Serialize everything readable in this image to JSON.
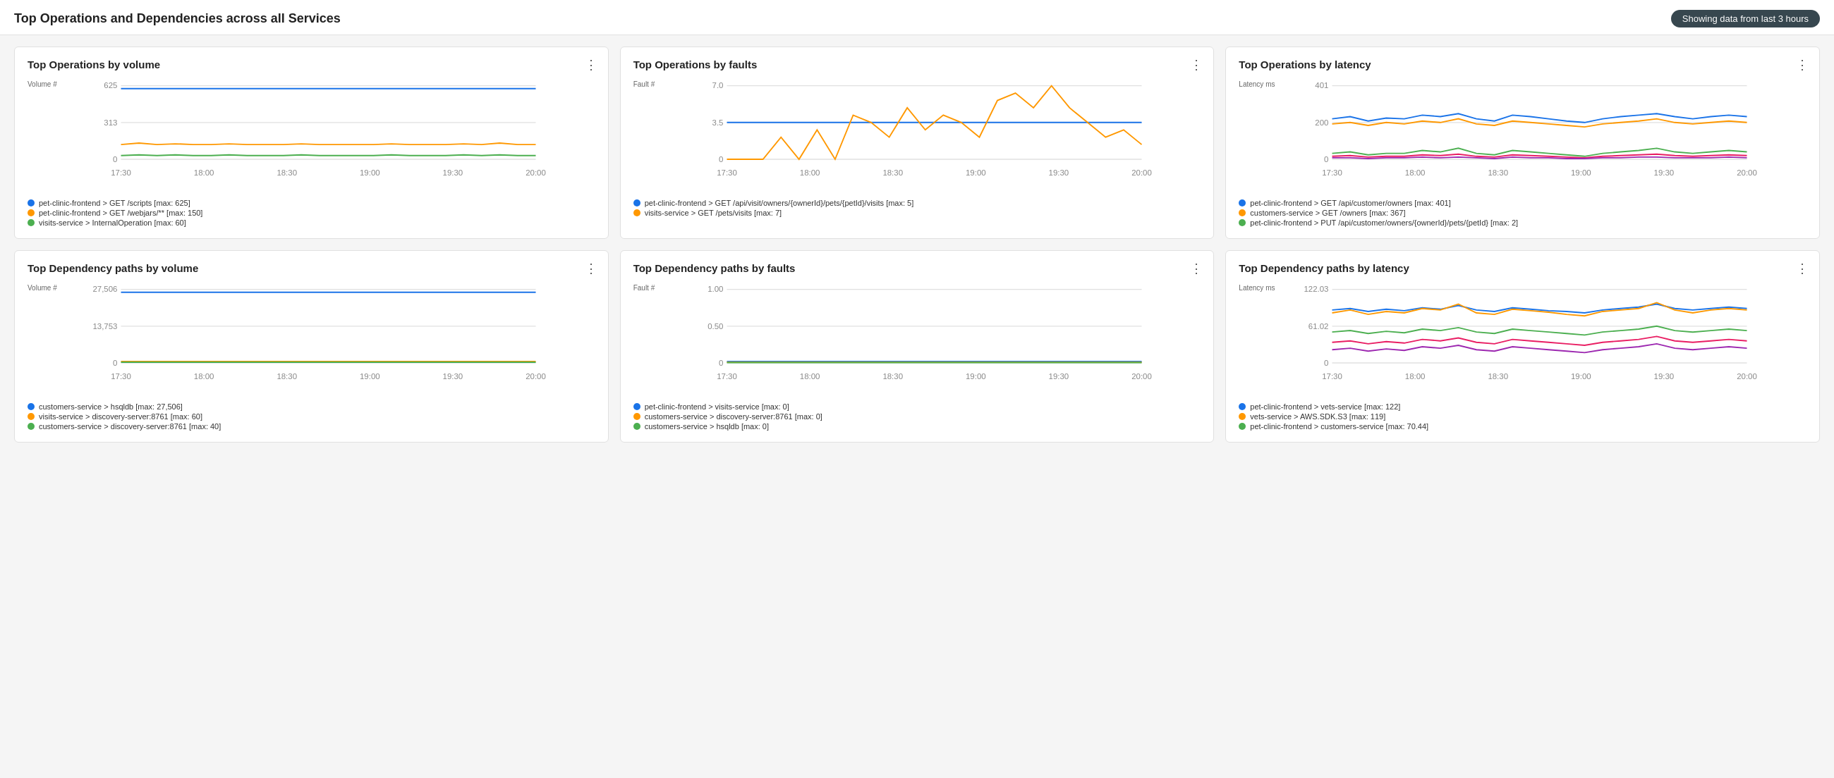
{
  "header": {
    "title": "Top Operations and Dependencies across all Services",
    "time_badge": "Showing data from last 3 hours"
  },
  "cards": [
    {
      "id": "top-ops-volume",
      "title": "Top Operations by volume",
      "y_axis_label": "Volume #",
      "y_ticks": [
        "625",
        "313",
        "0"
      ],
      "x_ticks": [
        "17:30",
        "18:00",
        "18:30",
        "19:00",
        "19:30",
        "20:00"
      ],
      "series": [
        {
          "color": "#1a73e8",
          "label": "pet-clinic-frontend > GET /scripts [max: 625]",
          "values": [
            0.96,
            0.96,
            0.96,
            0.96,
            0.96,
            0.96,
            0.96,
            0.96,
            0.96,
            0.96,
            0.96,
            0.96,
            0.96,
            0.96,
            0.96,
            0.96,
            0.96,
            0.96,
            0.96,
            0.96,
            0.96,
            0.96,
            0.96,
            0.96
          ]
        },
        {
          "color": "#ff9800",
          "label": "pet-clinic-frontend > GET /webjars/** [max: 150]",
          "values": [
            0.2,
            0.22,
            0.2,
            0.21,
            0.2,
            0.2,
            0.21,
            0.2,
            0.2,
            0.2,
            0.21,
            0.2,
            0.2,
            0.2,
            0.2,
            0.21,
            0.2,
            0.2,
            0.2,
            0.21,
            0.2,
            0.22,
            0.2,
            0.2
          ]
        },
        {
          "color": "#4caf50",
          "label": "visits-service > InternalOperation [max: 60]",
          "values": [
            0.05,
            0.06,
            0.05,
            0.06,
            0.05,
            0.05,
            0.06,
            0.05,
            0.05,
            0.05,
            0.06,
            0.05,
            0.05,
            0.05,
            0.05,
            0.06,
            0.05,
            0.05,
            0.05,
            0.06,
            0.05,
            0.06,
            0.05,
            0.05
          ]
        }
      ]
    },
    {
      "id": "top-ops-faults",
      "title": "Top Operations by faults",
      "y_axis_label": "Fault #",
      "y_ticks": [
        "7.0",
        "3.5",
        "0"
      ],
      "x_ticks": [
        "17:30",
        "18:00",
        "18:30",
        "19:00",
        "19:30",
        "20:00"
      ],
      "series": [
        {
          "color": "#1a73e8",
          "label": "pet-clinic-frontend > GET /api/visit/owners/{ownerId}/pets/{petId}/visits [max: 5]",
          "values": [
            0.5,
            0.5,
            0.5,
            0.5,
            0.5,
            0.5,
            0.5,
            0.5,
            0.5,
            0.5,
            0.5,
            0.5,
            0.5,
            0.5,
            0.5,
            0.5,
            0.5,
            0.5,
            0.5,
            0.5,
            0.5,
            0.5,
            0.5,
            0.5
          ]
        },
        {
          "color": "#ff9800",
          "label": "visits-service > GET /pets/visits [max: 7]",
          "values": [
            0,
            0,
            0,
            0.3,
            0,
            0.4,
            0,
            0.6,
            0.5,
            0.3,
            0.7,
            0.4,
            0.6,
            0.5,
            0.3,
            0.8,
            0.9,
            0.7,
            1.0,
            0.7,
            0.5,
            0.3,
            0.4,
            0.2
          ]
        }
      ]
    },
    {
      "id": "top-ops-latency",
      "title": "Top Operations by latency",
      "y_axis_label": "Latency ms",
      "y_ticks": [
        "401",
        "200",
        "0"
      ],
      "x_ticks": [
        "17:30",
        "18:00",
        "18:30",
        "19:00",
        "19:30",
        "20:00"
      ],
      "series": [
        {
          "color": "#1a73e8",
          "label": "pet-clinic-frontend > GET /api/customer/owners [max: 401]",
          "values": [
            0.55,
            0.58,
            0.52,
            0.56,
            0.55,
            0.6,
            0.58,
            0.62,
            0.55,
            0.52,
            0.6,
            0.58,
            0.55,
            0.52,
            0.5,
            0.55,
            0.58,
            0.6,
            0.62,
            0.58,
            0.55,
            0.58,
            0.6,
            0.58
          ]
        },
        {
          "color": "#ff9800",
          "label": "customers-service > GET /owners [max: 367]",
          "values": [
            0.48,
            0.5,
            0.46,
            0.5,
            0.48,
            0.52,
            0.5,
            0.55,
            0.48,
            0.46,
            0.52,
            0.5,
            0.48,
            0.46,
            0.44,
            0.48,
            0.5,
            0.52,
            0.55,
            0.5,
            0.48,
            0.5,
            0.52,
            0.5
          ]
        },
        {
          "color": "#4caf50",
          "label": "pet-clinic-frontend > PUT /api/customer/owners/{ownerId}/pets/{petId} [max: 2]",
          "values": [
            0.08,
            0.1,
            0.06,
            0.08,
            0.08,
            0.12,
            0.1,
            0.15,
            0.08,
            0.06,
            0.12,
            0.1,
            0.08,
            0.06,
            0.04,
            0.08,
            0.1,
            0.12,
            0.15,
            0.1,
            0.08,
            0.1,
            0.12,
            0.1
          ]
        },
        {
          "color": "#e91e63",
          "label": "",
          "values": [
            0.04,
            0.05,
            0.03,
            0.04,
            0.04,
            0.06,
            0.05,
            0.07,
            0.04,
            0.03,
            0.06,
            0.05,
            0.04,
            0.03,
            0.02,
            0.04,
            0.05,
            0.06,
            0.07,
            0.05,
            0.04,
            0.05,
            0.06,
            0.05
          ]
        },
        {
          "color": "#9c27b0",
          "label": "",
          "values": [
            0.02,
            0.02,
            0.01,
            0.02,
            0.02,
            0.03,
            0.02,
            0.03,
            0.02,
            0.01,
            0.03,
            0.02,
            0.02,
            0.01,
            0.01,
            0.02,
            0.02,
            0.03,
            0.03,
            0.02,
            0.02,
            0.02,
            0.03,
            0.02
          ]
        }
      ]
    },
    {
      "id": "top-dep-volume",
      "title": "Top Dependency paths by volume",
      "y_axis_label": "Volume #",
      "y_ticks": [
        "27,506",
        "13,753",
        "0"
      ],
      "x_ticks": [
        "17:30",
        "18:00",
        "18:30",
        "19:00",
        "19:30",
        "20:00"
      ],
      "series": [
        {
          "color": "#1a73e8",
          "label": "customers-service > hsqldb [max: 27,506]",
          "values": [
            0.96,
            0.96,
            0.96,
            0.96,
            0.96,
            0.96,
            0.96,
            0.96,
            0.96,
            0.96,
            0.96,
            0.96,
            0.96,
            0.96,
            0.96,
            0.96,
            0.96,
            0.96,
            0.96,
            0.96,
            0.96,
            0.96,
            0.96,
            0.96
          ]
        },
        {
          "color": "#ff9800",
          "label": "visits-service > discovery-server:8761 [max: 60]",
          "values": [
            0.02,
            0.02,
            0.02,
            0.02,
            0.02,
            0.02,
            0.02,
            0.02,
            0.02,
            0.02,
            0.02,
            0.02,
            0.02,
            0.02,
            0.02,
            0.02,
            0.02,
            0.02,
            0.02,
            0.02,
            0.02,
            0.02,
            0.02,
            0.02
          ]
        },
        {
          "color": "#4caf50",
          "label": "customers-service > discovery-server:8761 [max: 40]",
          "values": [
            0.01,
            0.01,
            0.01,
            0.01,
            0.01,
            0.01,
            0.01,
            0.01,
            0.01,
            0.01,
            0.01,
            0.01,
            0.01,
            0.01,
            0.01,
            0.01,
            0.01,
            0.01,
            0.01,
            0.01,
            0.01,
            0.01,
            0.01,
            0.01
          ]
        }
      ]
    },
    {
      "id": "top-dep-faults",
      "title": "Top Dependency paths by faults",
      "y_axis_label": "Fault #",
      "y_ticks": [
        "1.00",
        "0.50",
        "0"
      ],
      "x_ticks": [
        "17:30",
        "18:00",
        "18:30",
        "19:00",
        "19:30",
        "20:00"
      ],
      "series": [
        {
          "color": "#1a73e8",
          "label": "pet-clinic-frontend > visits-service [max: 0]",
          "values": [
            0.02,
            0.02,
            0.02,
            0.02,
            0.02,
            0.02,
            0.02,
            0.02,
            0.02,
            0.02,
            0.02,
            0.02,
            0.02,
            0.02,
            0.02,
            0.02,
            0.02,
            0.02,
            0.02,
            0.02,
            0.02,
            0.02,
            0.02,
            0.02
          ]
        },
        {
          "color": "#ff9800",
          "label": "customers-service > discovery-server:8761 [max: 0]",
          "values": [
            0.01,
            0.01,
            0.01,
            0.01,
            0.01,
            0.01,
            0.01,
            0.01,
            0.01,
            0.01,
            0.01,
            0.01,
            0.01,
            0.01,
            0.01,
            0.01,
            0.01,
            0.01,
            0.01,
            0.01,
            0.01,
            0.01,
            0.01,
            0.01
          ]
        },
        {
          "color": "#4caf50",
          "label": "customers-service > hsqldb [max: 0]",
          "values": [
            0.005,
            0.005,
            0.005,
            0.005,
            0.005,
            0.005,
            0.005,
            0.005,
            0.005,
            0.005,
            0.005,
            0.005,
            0.005,
            0.005,
            0.005,
            0.005,
            0.005,
            0.005,
            0.005,
            0.005,
            0.005,
            0.005,
            0.005,
            0.005
          ]
        }
      ]
    },
    {
      "id": "top-dep-latency",
      "title": "Top Dependency paths by latency",
      "y_axis_label": "Latency ms",
      "y_ticks": [
        "122.03",
        "61.02",
        "0"
      ],
      "x_ticks": [
        "17:30",
        "18:00",
        "18:30",
        "19:00",
        "19:30",
        "20:00"
      ],
      "series": [
        {
          "color": "#1a73e8",
          "label": "pet-clinic-frontend > vets-service [max: 122]",
          "values": [
            0.72,
            0.74,
            0.7,
            0.73,
            0.71,
            0.75,
            0.73,
            0.78,
            0.72,
            0.7,
            0.75,
            0.73,
            0.71,
            0.7,
            0.68,
            0.72,
            0.74,
            0.76,
            0.8,
            0.74,
            0.72,
            0.74,
            0.76,
            0.74
          ]
        },
        {
          "color": "#ff9800",
          "label": "vets-service > AWS.SDK.S3 [max: 119]",
          "values": [
            0.68,
            0.72,
            0.66,
            0.7,
            0.68,
            0.74,
            0.72,
            0.8,
            0.68,
            0.66,
            0.73,
            0.71,
            0.69,
            0.66,
            0.64,
            0.7,
            0.72,
            0.74,
            0.82,
            0.72,
            0.68,
            0.72,
            0.74,
            0.72
          ]
        },
        {
          "color": "#4caf50",
          "label": "pet-clinic-frontend > customers-service [max: 70.44]",
          "values": [
            0.42,
            0.44,
            0.4,
            0.43,
            0.41,
            0.46,
            0.44,
            0.48,
            0.42,
            0.4,
            0.46,
            0.44,
            0.42,
            0.4,
            0.38,
            0.42,
            0.44,
            0.46,
            0.5,
            0.44,
            0.42,
            0.44,
            0.46,
            0.44
          ]
        },
        {
          "color": "#e91e63",
          "label": "",
          "values": [
            0.28,
            0.3,
            0.26,
            0.29,
            0.27,
            0.32,
            0.3,
            0.34,
            0.28,
            0.26,
            0.32,
            0.3,
            0.28,
            0.26,
            0.24,
            0.28,
            0.3,
            0.32,
            0.36,
            0.3,
            0.28,
            0.3,
            0.32,
            0.3
          ]
        },
        {
          "color": "#9c27b0",
          "label": "",
          "values": [
            0.18,
            0.2,
            0.16,
            0.19,
            0.17,
            0.22,
            0.2,
            0.24,
            0.18,
            0.16,
            0.22,
            0.2,
            0.18,
            0.16,
            0.14,
            0.18,
            0.2,
            0.22,
            0.26,
            0.2,
            0.18,
            0.2,
            0.22,
            0.2
          ]
        }
      ]
    }
  ],
  "menu_icon": "⋮"
}
